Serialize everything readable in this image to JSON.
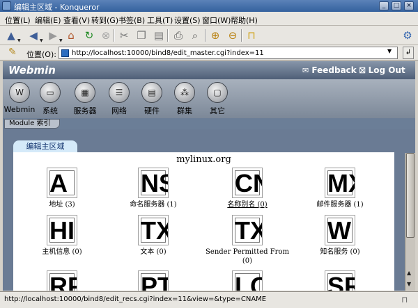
{
  "window": {
    "title": "编辑主区域 - Konqueror"
  },
  "menubar": [
    "位置(L)",
    "编辑(E)",
    "查看(V)",
    "转到(G)",
    "书签(B)",
    "工具(T)",
    "设置(S)",
    "窗口(W)",
    "帮助(H)"
  ],
  "location": {
    "label": "位置(O):",
    "url": "http://localhost:10000/bind8/edit_master.cgi?index=11"
  },
  "webmin": {
    "logo": "Webmin",
    "feedback": "Feedback",
    "logout": "Log Out",
    "categories": [
      "Webmin",
      "系统",
      "服务器",
      "网络",
      "硬件",
      "群集",
      "其它"
    ],
    "module_index": "Module 索引"
  },
  "page": {
    "tab_title": "编辑主区域",
    "host": "mylinux.org",
    "records": [
      {
        "glyph": "A",
        "label": "地址 (3)"
      },
      {
        "glyph": "NS",
        "label": "命名服务器 (1)"
      },
      {
        "glyph": "CN",
        "label": "名称别名 (0)"
      },
      {
        "glyph": "MX",
        "label": "邮件服务器 (1)"
      },
      {
        "glyph": "HI",
        "label": "主机信息 (0)"
      },
      {
        "glyph": "TX",
        "label": "文本 (0)"
      },
      {
        "glyph": "TX",
        "label": "Sender Permitted From (0)"
      },
      {
        "glyph": "W",
        "label": "知名服务 (0)"
      },
      {
        "glyph": "RP",
        "label": ""
      },
      {
        "glyph": "PT",
        "label": ""
      },
      {
        "glyph": "LO",
        "label": ""
      },
      {
        "glyph": "SR",
        "label": ""
      }
    ]
  },
  "statusbar": {
    "text": "http://localhost:10000/bind8/edit_recs.cgi?index=11&view=&type=CNAME"
  }
}
